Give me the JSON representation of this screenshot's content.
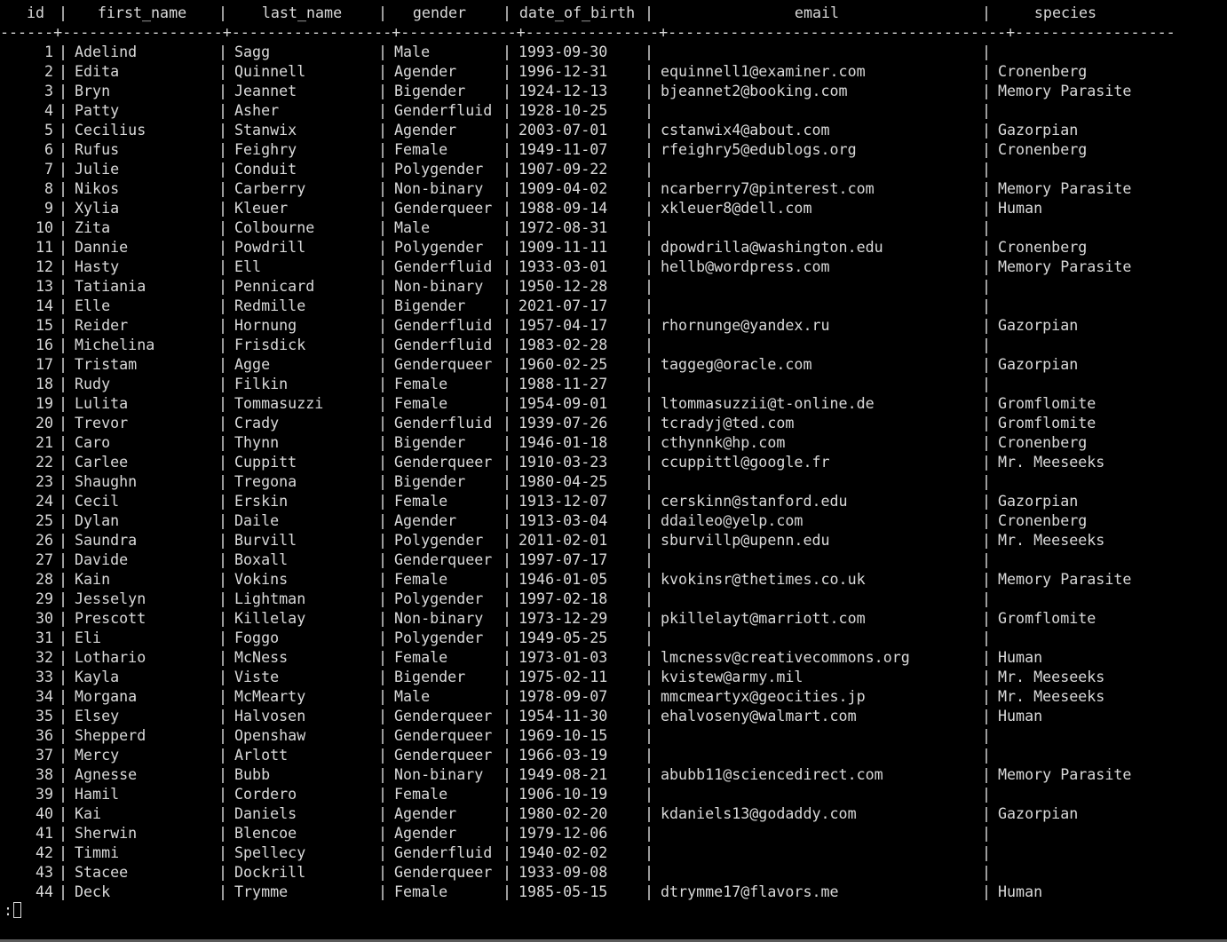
{
  "terminal": {
    "pager_prompt": ":",
    "columns": [
      "id",
      "first_name",
      "last_name",
      "gender",
      "date_of_birth",
      "email",
      "species"
    ],
    "rows": [
      [
        "1",
        "Adelind",
        "Sagg",
        "Male",
        "1993-09-30",
        "",
        ""
      ],
      [
        "2",
        "Edita",
        "Quinnell",
        "Agender",
        "1996-12-31",
        "equinnell1@examiner.com",
        "Cronenberg"
      ],
      [
        "3",
        "Bryn",
        "Jeannet",
        "Bigender",
        "1924-12-13",
        "bjeannet2@booking.com",
        "Memory Parasite"
      ],
      [
        "4",
        "Patty",
        "Asher",
        "Genderfluid",
        "1928-10-25",
        "",
        ""
      ],
      [
        "5",
        "Cecilius",
        "Stanwix",
        "Agender",
        "2003-07-01",
        "cstanwix4@about.com",
        "Gazorpian"
      ],
      [
        "6",
        "Rufus",
        "Feighry",
        "Female",
        "1949-11-07",
        "rfeighry5@edublogs.org",
        "Cronenberg"
      ],
      [
        "7",
        "Julie",
        "Conduit",
        "Polygender",
        "1907-09-22",
        "",
        ""
      ],
      [
        "8",
        "Nikos",
        "Carberry",
        "Non-binary",
        "1909-04-02",
        "ncarberry7@pinterest.com",
        "Memory Parasite"
      ],
      [
        "9",
        "Xylia",
        "Kleuer",
        "Genderqueer",
        "1988-09-14",
        "xkleuer8@dell.com",
        "Human"
      ],
      [
        "10",
        "Zita",
        "Colbourne",
        "Male",
        "1972-08-31",
        "",
        ""
      ],
      [
        "11",
        "Dannie",
        "Powdrill",
        "Polygender",
        "1909-11-11",
        "dpowdrilla@washington.edu",
        "Cronenberg"
      ],
      [
        "12",
        "Hasty",
        "Ell",
        "Genderfluid",
        "1933-03-01",
        "hellb@wordpress.com",
        "Memory Parasite"
      ],
      [
        "13",
        "Tatiania",
        "Pennicard",
        "Non-binary",
        "1950-12-28",
        "",
        ""
      ],
      [
        "14",
        "Elle",
        "Redmille",
        "Bigender",
        "2021-07-17",
        "",
        ""
      ],
      [
        "15",
        "Reider",
        "Hornung",
        "Genderfluid",
        "1957-04-17",
        "rhornunge@yandex.ru",
        "Gazorpian"
      ],
      [
        "16",
        "Michelina",
        "Frisdick",
        "Genderfluid",
        "1983-02-28",
        "",
        ""
      ],
      [
        "17",
        "Tristam",
        "Agge",
        "Genderqueer",
        "1960-02-25",
        "taggeg@oracle.com",
        "Gazorpian"
      ],
      [
        "18",
        "Rudy",
        "Filkin",
        "Female",
        "1988-11-27",
        "",
        ""
      ],
      [
        "19",
        "Lulita",
        "Tommasuzzi",
        "Female",
        "1954-09-01",
        "ltommasuzzii@t-online.de",
        "Gromflomite"
      ],
      [
        "20",
        "Trevor",
        "Crady",
        "Genderfluid",
        "1939-07-26",
        "tcradyj@ted.com",
        "Gromflomite"
      ],
      [
        "21",
        "Caro",
        "Thynn",
        "Bigender",
        "1946-01-18",
        "cthynnk@hp.com",
        "Cronenberg"
      ],
      [
        "22",
        "Carlee",
        "Cuppitt",
        "Genderqueer",
        "1910-03-23",
        "ccuppittl@google.fr",
        "Mr. Meeseeks"
      ],
      [
        "23",
        "Shaughn",
        "Tregona",
        "Bigender",
        "1980-04-25",
        "",
        ""
      ],
      [
        "24",
        "Cecil",
        "Erskin",
        "Female",
        "1913-12-07",
        "cerskinn@stanford.edu",
        "Gazorpian"
      ],
      [
        "25",
        "Dylan",
        "Daile",
        "Agender",
        "1913-03-04",
        "ddaileo@yelp.com",
        "Cronenberg"
      ],
      [
        "26",
        "Saundra",
        "Burvill",
        "Polygender",
        "2011-02-01",
        "sburvillp@upenn.edu",
        "Mr. Meeseeks"
      ],
      [
        "27",
        "Davide",
        "Boxall",
        "Genderqueer",
        "1997-07-17",
        "",
        ""
      ],
      [
        "28",
        "Kain",
        "Vokins",
        "Female",
        "1946-01-05",
        "kvokinsr@thetimes.co.uk",
        "Memory Parasite"
      ],
      [
        "29",
        "Jesselyn",
        "Lightman",
        "Polygender",
        "1997-02-18",
        "",
        ""
      ],
      [
        "30",
        "Prescott",
        "Killelay",
        "Non-binary",
        "1973-12-29",
        "pkillelayt@marriott.com",
        "Gromflomite"
      ],
      [
        "31",
        "Eli",
        "Foggo",
        "Polygender",
        "1949-05-25",
        "",
        ""
      ],
      [
        "32",
        "Lothario",
        "McNess",
        "Female",
        "1973-01-03",
        "lmcnessv@creativecommons.org",
        "Human"
      ],
      [
        "33",
        "Kayla",
        "Viste",
        "Bigender",
        "1975-02-11",
        "kvistew@army.mil",
        "Mr. Meeseeks"
      ],
      [
        "34",
        "Morgana",
        "McMearty",
        "Male",
        "1978-09-07",
        "mmcmeartyx@geocities.jp",
        "Mr. Meeseeks"
      ],
      [
        "35",
        "Elsey",
        "Halvosen",
        "Genderqueer",
        "1954-11-30",
        "ehalvoseny@walmart.com",
        "Human"
      ],
      [
        "36",
        "Shepperd",
        "Openshaw",
        "Genderqueer",
        "1969-10-15",
        "",
        ""
      ],
      [
        "37",
        "Mercy",
        "Arlott",
        "Genderqueer",
        "1966-03-19",
        "",
        ""
      ],
      [
        "38",
        "Agnesse",
        "Bubb",
        "Non-binary",
        "1949-08-21",
        "abubb11@sciencedirect.com",
        "Memory Parasite"
      ],
      [
        "39",
        "Hamil",
        "Cordero",
        "Female",
        "1906-10-19",
        "",
        ""
      ],
      [
        "40",
        "Kai",
        "Daniels",
        "Agender",
        "1980-02-20",
        "kdaniels13@godaddy.com",
        "Gazorpian"
      ],
      [
        "41",
        "Sherwin",
        "Blencoe",
        "Agender",
        "1979-12-06",
        "",
        ""
      ],
      [
        "42",
        "Timmi",
        "Spellecy",
        "Genderfluid",
        "1940-02-02",
        "",
        ""
      ],
      [
        "43",
        "Stacee",
        "Dockrill",
        "Genderqueer",
        "1933-09-08",
        "",
        ""
      ],
      [
        "44",
        "Deck",
        "Trymme",
        "Female",
        "1985-05-15",
        "dtrymme17@flavors.me",
        "Human"
      ]
    ]
  }
}
